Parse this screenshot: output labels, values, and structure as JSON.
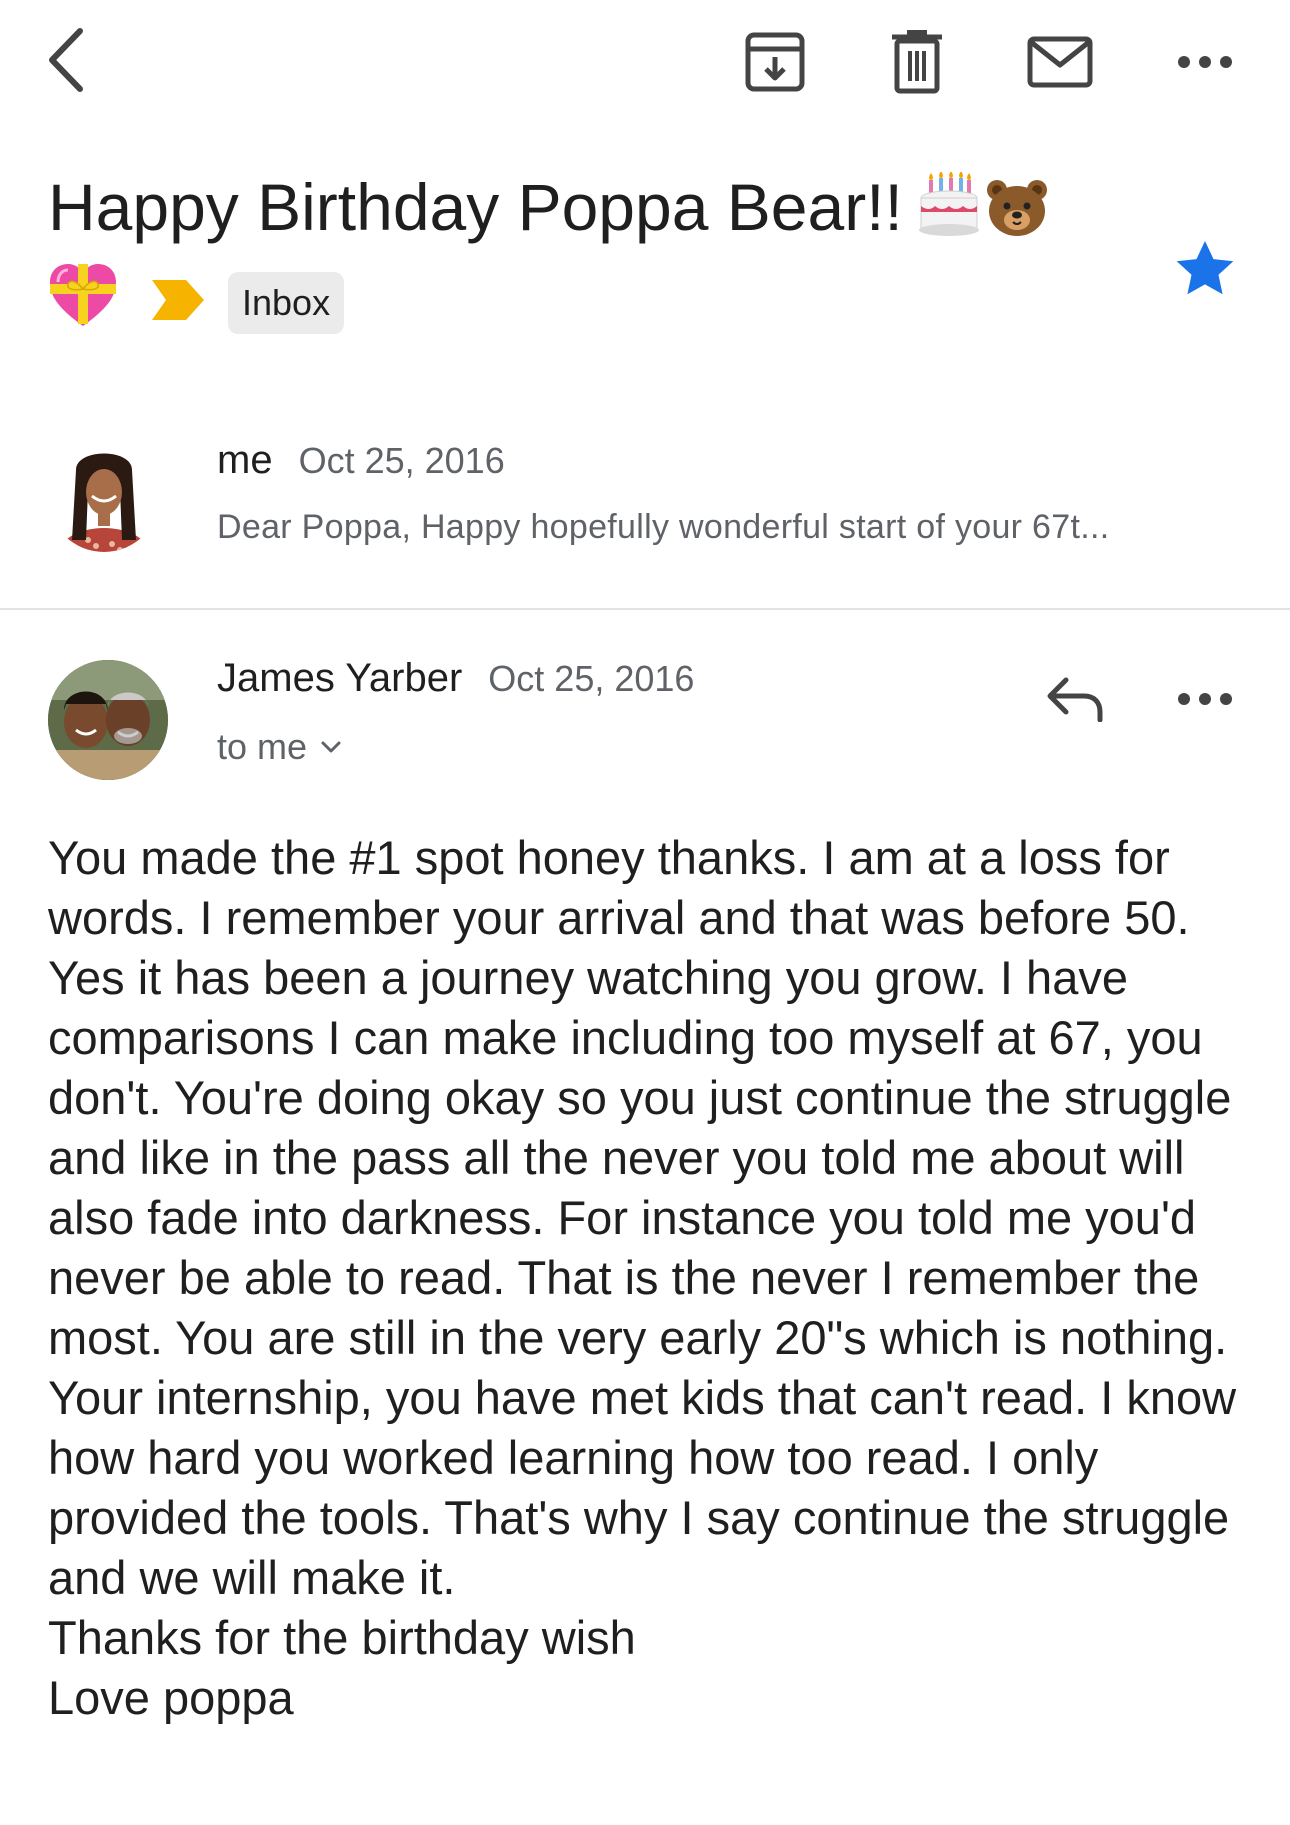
{
  "toolbar": {
    "icons": [
      "back-arrow-icon",
      "archive-icon",
      "trash-icon",
      "mark-unread-icon",
      "more-options-icon"
    ]
  },
  "subject": {
    "text": "Happy Birthday Poppa Bear!!",
    "emojis": [
      "🎂",
      "🐻",
      "💝"
    ]
  },
  "labels": {
    "importance_color": "#f6b400",
    "inbox": "Inbox"
  },
  "starred": true,
  "star_color": "#1a73e8",
  "messages": [
    {
      "sender": "me",
      "date": "Oct 25, 2016",
      "snippet": "Dear Poppa, Happy hopefully wonderful start of your 67t..."
    },
    {
      "sender": "James Yarber",
      "date": "Oct 25, 2016",
      "recipient": "to me",
      "body": [
        "You made the #1 spot honey thanks. I am at a loss for words. I remember your arrival and that was before 50. Yes it has been a journey watching you grow. I have comparisons I can make including too myself at 67, you don't. You're doing okay so you just continue the struggle and like in the pass all the never you told me about will also fade into darkness. For instance you told me you'd never be able to read. That is the never I remember the most. You are still in the very early 20\"s which is nothing. Your internship, you have met kids that can't read. I know how hard you worked learning how too read. I only provided the tools. That's why I say continue the struggle and we will make it.",
        "Thanks for the birthday wish",
        "Love poppa"
      ]
    }
  ]
}
